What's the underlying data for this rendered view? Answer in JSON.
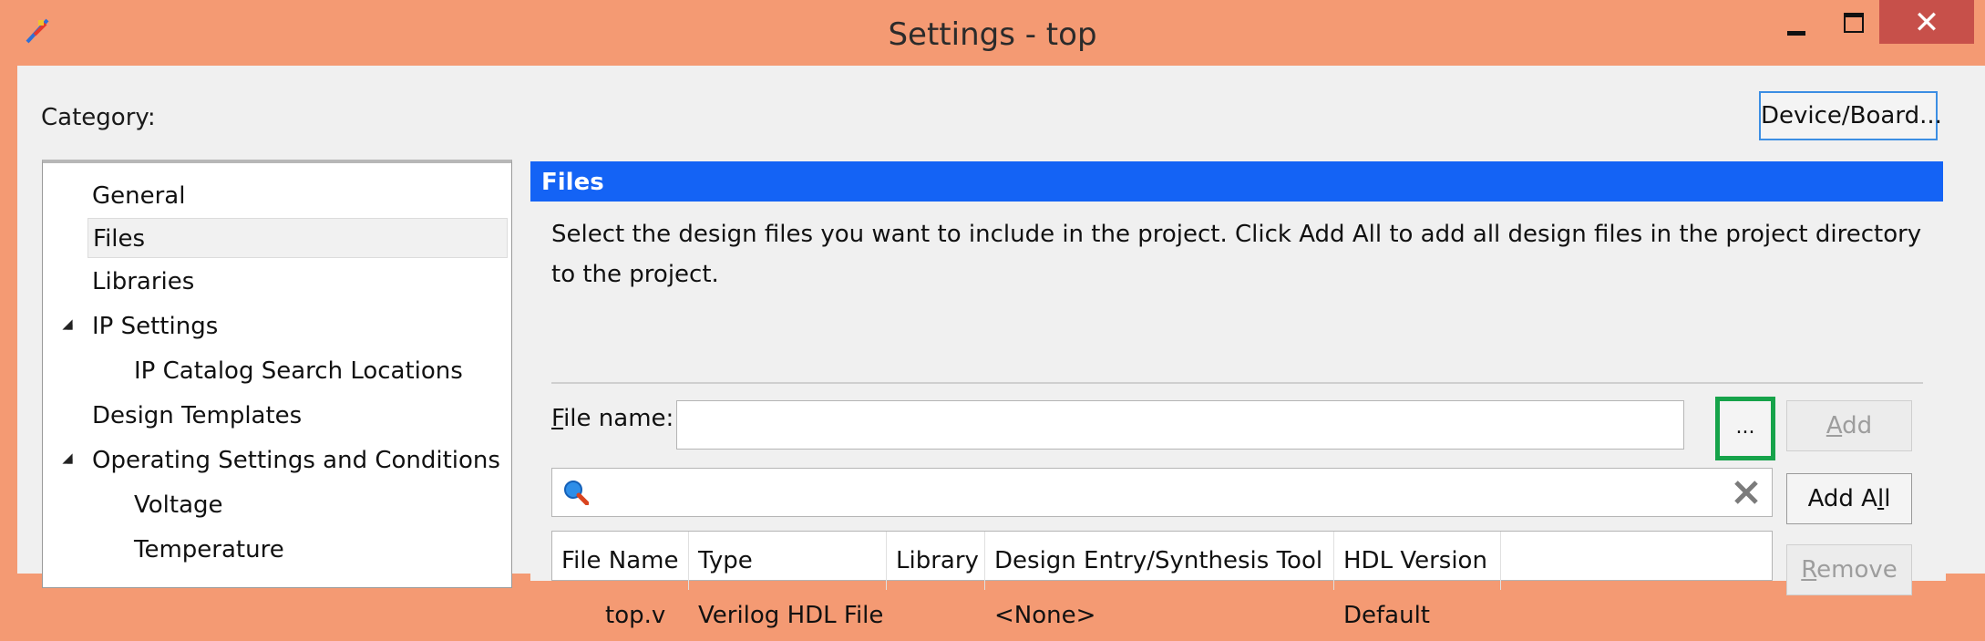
{
  "window": {
    "title": "Settings - top",
    "close_glyph": "✕"
  },
  "category_label": "Category:",
  "device_board_button": "Device/Board...",
  "tree": {
    "items": [
      {
        "label": "General"
      },
      {
        "label": "Files",
        "selected": true
      },
      {
        "label": "Libraries"
      },
      {
        "label": "IP Settings",
        "expanded": true
      },
      {
        "label": "IP Catalog Search Locations"
      },
      {
        "label": "Design Templates"
      },
      {
        "label": "Operating Settings and Conditions",
        "expanded": true
      },
      {
        "label": "Voltage"
      },
      {
        "label": "Temperature"
      }
    ]
  },
  "files": {
    "header": "Files",
    "description": "Select the design files you want to include in the project. Click Add All to add all design files in the project directory to the project.",
    "file_name_label_u": "F",
    "file_name_label_rest": "ile name:",
    "file_name_value": "",
    "browse_label": "...",
    "search_value": "",
    "buttons": {
      "add_u": "A",
      "add_rest": "dd",
      "add_all_pre": "Add A",
      "add_all_u": "l",
      "add_all_post": "l",
      "remove_u": "R",
      "remove_rest": "emove"
    },
    "columns": [
      "File Name",
      "Type",
      "Library",
      "Design Entry/Synthesis Tool",
      "HDL Version"
    ],
    "rows": [
      {
        "file_name": "top.v",
        "type": "Verilog HDL File",
        "library": "",
        "tool": "<None>",
        "hdl": "Default"
      }
    ]
  },
  "colors": {
    "titlebar": "#f49a73",
    "files_header": "#1463f5",
    "highlight_border": "#16a34a",
    "close_button": "#c7504a"
  },
  "icons": {
    "app": "quartus-app-icon",
    "search": "magnifier-icon",
    "clear": "clear-x-icon"
  }
}
